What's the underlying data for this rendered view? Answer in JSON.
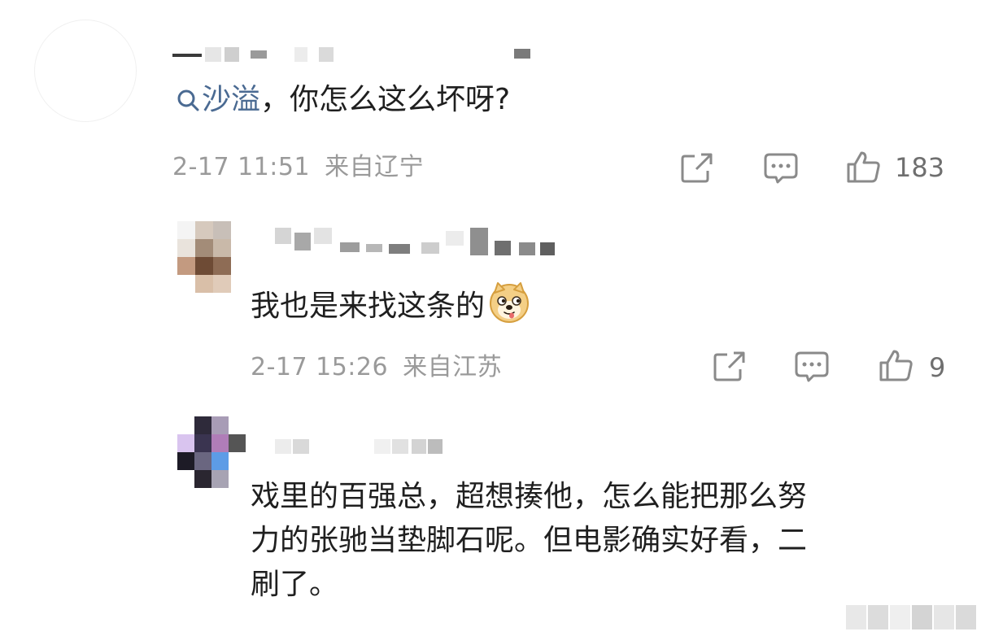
{
  "comments": [
    {
      "topic": "沙溢",
      "text": "，你怎么这么坏呀?",
      "timestamp": "2-17 11:51",
      "location": "来自辽宁",
      "like_count": "183",
      "share_icon": "share-icon",
      "reply_icon": "comment-icon",
      "like_icon": "thumbs-up-icon"
    },
    {
      "text": "我也是来找这条的",
      "emoji": "doge-emoji",
      "timestamp": "2-17 15:26",
      "location": "来自江苏",
      "like_count": "9",
      "share_icon": "share-icon",
      "reply_icon": "comment-icon",
      "like_icon": "thumbs-up-icon"
    },
    {
      "lines": [
        "戏里的百强总，超想揍他，怎么能把那么努",
        "力的张驰当垫脚石呢。但电影确实好看，二",
        "刷了。"
      ]
    }
  ],
  "colors": {
    "topic_link": "#4a6a92",
    "meta_gray": "#9a9a9a",
    "text": "#1f1f1f"
  }
}
